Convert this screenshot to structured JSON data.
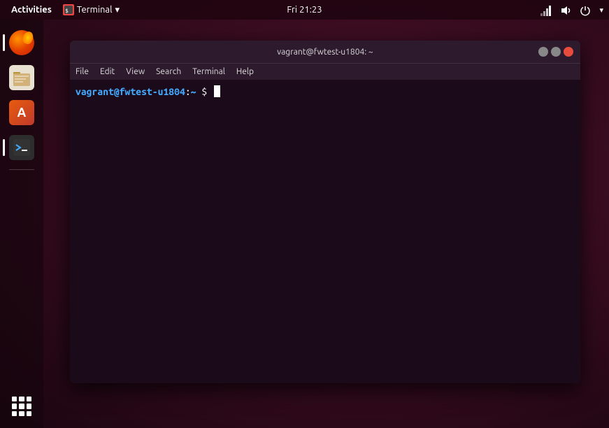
{
  "topbar": {
    "activities_label": "Activities",
    "app_menu_label": "Terminal",
    "app_menu_arrow": "▾",
    "clock": "Fri 21:23",
    "network_icon": "network-icon",
    "sound_icon": "volume-icon",
    "power_icon": "power-icon",
    "power_arrow": "▾"
  },
  "dock": {
    "items": [
      {
        "name": "firefox",
        "label": "Firefox"
      },
      {
        "name": "files",
        "label": "Files"
      },
      {
        "name": "software-center",
        "label": "Software Center"
      },
      {
        "name": "terminal",
        "label": "Terminal"
      }
    ],
    "apps_grid_label": "Show Applications"
  },
  "terminal": {
    "title": "vagrant@fwtest-u1804: ~",
    "menubar": {
      "file": "File",
      "edit": "Edit",
      "view": "View",
      "search": "Search",
      "terminal": "Terminal",
      "help": "Help"
    },
    "window_controls": {
      "minimize": "─",
      "maximize": "□",
      "close": "✕"
    },
    "prompt": {
      "user_host": "vagrant@fwtest-u1804",
      "separator": ":",
      "directory": "~",
      "symbol": "$"
    }
  }
}
